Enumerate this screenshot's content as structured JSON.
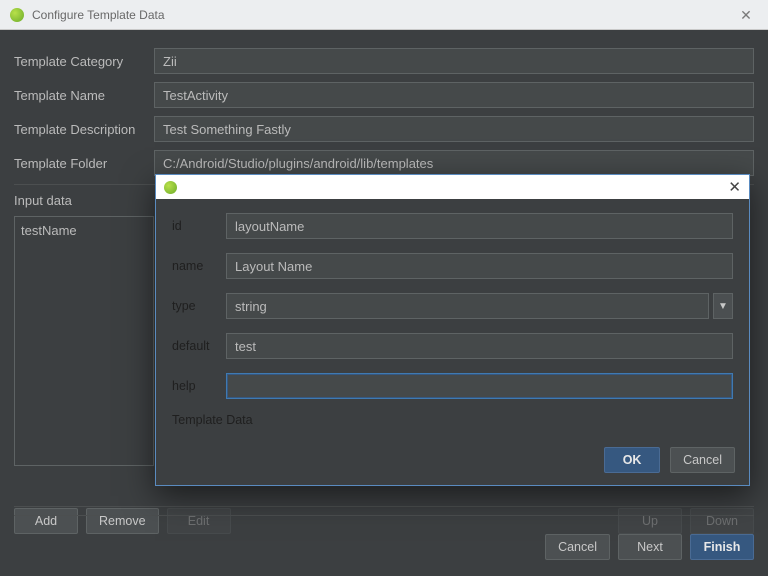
{
  "window": {
    "title": "Configure Template Data"
  },
  "form": {
    "category_label": "Template Category",
    "category_value": "Zii",
    "name_label": "Template Name",
    "name_value": "TestActivity",
    "desc_label": "Template Description",
    "desc_value": "Test Something Fastly",
    "folder_label": "Template Folder",
    "folder_value": "C:/Android/Studio/plugins/android/lib/templates",
    "input_data_label": "Input data"
  },
  "input_list": {
    "items": [
      "testName"
    ]
  },
  "list_buttons": {
    "add": "Add",
    "remove": "Remove",
    "edit": "Edit",
    "up": "Up",
    "down": "Down"
  },
  "footer": {
    "cancel": "Cancel",
    "next": "Next",
    "finish": "Finish"
  },
  "modal": {
    "fields": {
      "id_label": "id",
      "id_value": "layoutName",
      "name_label": "name",
      "name_value": "Layout Name",
      "type_label": "type",
      "type_value": "string",
      "default_label": "default",
      "default_value": "test",
      "help_label": "help",
      "help_value": ""
    },
    "caption": "Template Data",
    "ok": "OK",
    "cancel": "Cancel"
  }
}
